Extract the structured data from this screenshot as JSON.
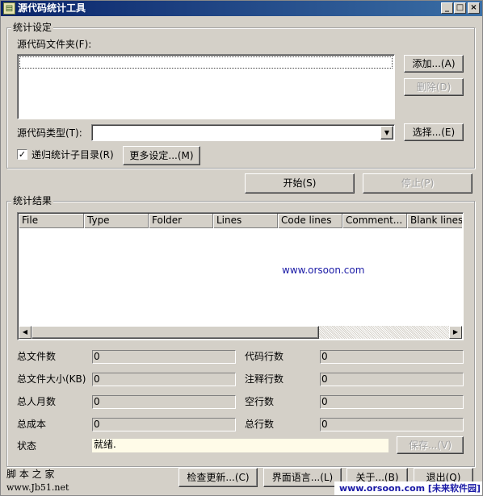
{
  "window": {
    "title": "源代码统计工具",
    "title_icon_glyph": "▤",
    "controls": {
      "minimize": "_",
      "maximize": "□",
      "close": "×"
    }
  },
  "settings": {
    "group_title": "统计设定",
    "source_folder_label": "源代码文件夹(F):",
    "source_folder_value": "",
    "add_button": "添加...(A)",
    "remove_button": "删除(D)",
    "source_type_label": "源代码类型(T):",
    "source_type_value": "",
    "dropdown_arrow": "▼",
    "select_button": "选择...(E)",
    "recurse_label": "递归统计子目录(R)",
    "recurse_checked": true,
    "check_glyph": "✓",
    "more_settings_button": "更多设定...(M)"
  },
  "actions": {
    "start_button": "开始(S)",
    "stop_button": "停止(P)"
  },
  "results": {
    "group_title": "统计结果",
    "columns": [
      "File",
      "Type",
      "Folder",
      "Lines",
      "Code lines",
      "Comment...",
      "Blank lines"
    ],
    "rows": [],
    "scroll_left": "◀",
    "scroll_right": "▶"
  },
  "summary": {
    "total_files_label": "总文件数",
    "total_files_value": "0",
    "total_size_label": "总文件大小(KB)",
    "total_size_value": "0",
    "man_months_label": "总人月数",
    "man_months_value": "0",
    "total_cost_label": "总成本",
    "total_cost_value": "0",
    "code_lines_label": "代码行数",
    "code_lines_value": "0",
    "comment_lines_label": "注释行数",
    "comment_lines_value": "0",
    "blank_lines_label": "空行数",
    "blank_lines_value": "0",
    "total_lines_label": "总行数",
    "total_lines_value": "0",
    "status_label": "状态",
    "status_value": "就绪.",
    "save_button": "保存...(V)"
  },
  "footer": {
    "check_update_button": "检查更新...(C)",
    "language_button": "界面语言...(L)",
    "about_button": "关于...(B)",
    "exit_button": "退出(Q)"
  },
  "watermarks": {
    "center_url": "www.orsoon.com",
    "jb51_title": "脚 本 之 家",
    "jb51_url": "www.Jb51.net",
    "orsoon_footer": "www.orsoon.com [未来软件园]"
  },
  "colors": {
    "titlebar_start": "#0a246a",
    "titlebar_end": "#3a6ea5",
    "face": "#d4d0c8",
    "status_background": "#fffbe8",
    "watermark": "#1a1aa6"
  }
}
